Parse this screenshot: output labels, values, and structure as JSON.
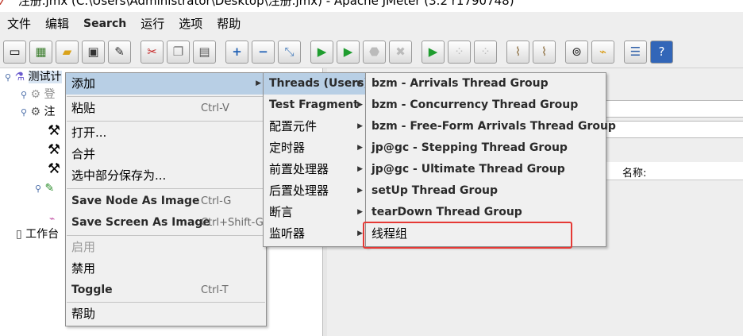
{
  "window": {
    "title": "注册.jmx (C:\\Users\\Administrator\\Desktop\\注册.jmx) - Apache JMeter (3.2 r1790748)"
  },
  "menubar": [
    "文件",
    "编辑",
    "Search",
    "运行",
    "选项",
    "帮助"
  ],
  "toolbar": {
    "icons": [
      "new-icon",
      "templates-icon",
      "open-icon",
      "save-icon",
      "save-as-icon",
      "cut-icon",
      "copy-icon",
      "paste-icon",
      "expand-icon",
      "collapse-icon",
      "toggle-icon",
      "start-icon",
      "start-no-pause-icon",
      "stop-icon",
      "shutdown-icon",
      "remote-start-icon",
      "remote-stop-icon",
      "remote-shutdown-icon",
      "clear-icon",
      "clear-all-icon",
      "search-icon",
      "reset-search-icon",
      "function-helper-icon",
      "help-icon"
    ]
  },
  "tree": {
    "items": [
      {
        "label": "测试计"
      },
      {
        "label": "登"
      },
      {
        "label": "注"
      },
      {
        "label": "工作台"
      }
    ]
  },
  "right_panel": {
    "name_label": "名称:"
  },
  "context_menu": {
    "items": [
      {
        "label": "添加",
        "accel": "",
        "submenu": true
      },
      {
        "label": "粘贴",
        "accel": "Ctrl-V"
      },
      {
        "label": "打开..."
      },
      {
        "label": "合并"
      },
      {
        "label": "选中部分保存为..."
      },
      {
        "label": "Save Node As Image",
        "accel": "Ctrl-G"
      },
      {
        "label": "Save Screen As Image",
        "accel": "Ctrl+Shift-G"
      },
      {
        "label": "启用",
        "disabled": true
      },
      {
        "label": "禁用"
      },
      {
        "label": "Toggle",
        "accel": "Ctrl-T"
      },
      {
        "label": "帮助"
      }
    ]
  },
  "add_submenu": {
    "items": [
      "Threads (Users)",
      "Test Fragment",
      "配置元件",
      "定时器",
      "前置处理器",
      "后置处理器",
      "断言",
      "监听器"
    ]
  },
  "threads_submenu": {
    "items": [
      "bzm - Arrivals Thread Group",
      "bzm - Concurrency Thread Group",
      "bzm - Free-Form Arrivals Thread Group",
      "jp@gc - Stepping Thread Group",
      "jp@gc - Ultimate Thread Group",
      "setUp Thread Group",
      "tearDown Thread Group",
      "线程组"
    ]
  },
  "colors": {
    "menu_bg": "#f0f0f0",
    "selection": "#b8cfe5",
    "highlight_box": "#e53935"
  }
}
